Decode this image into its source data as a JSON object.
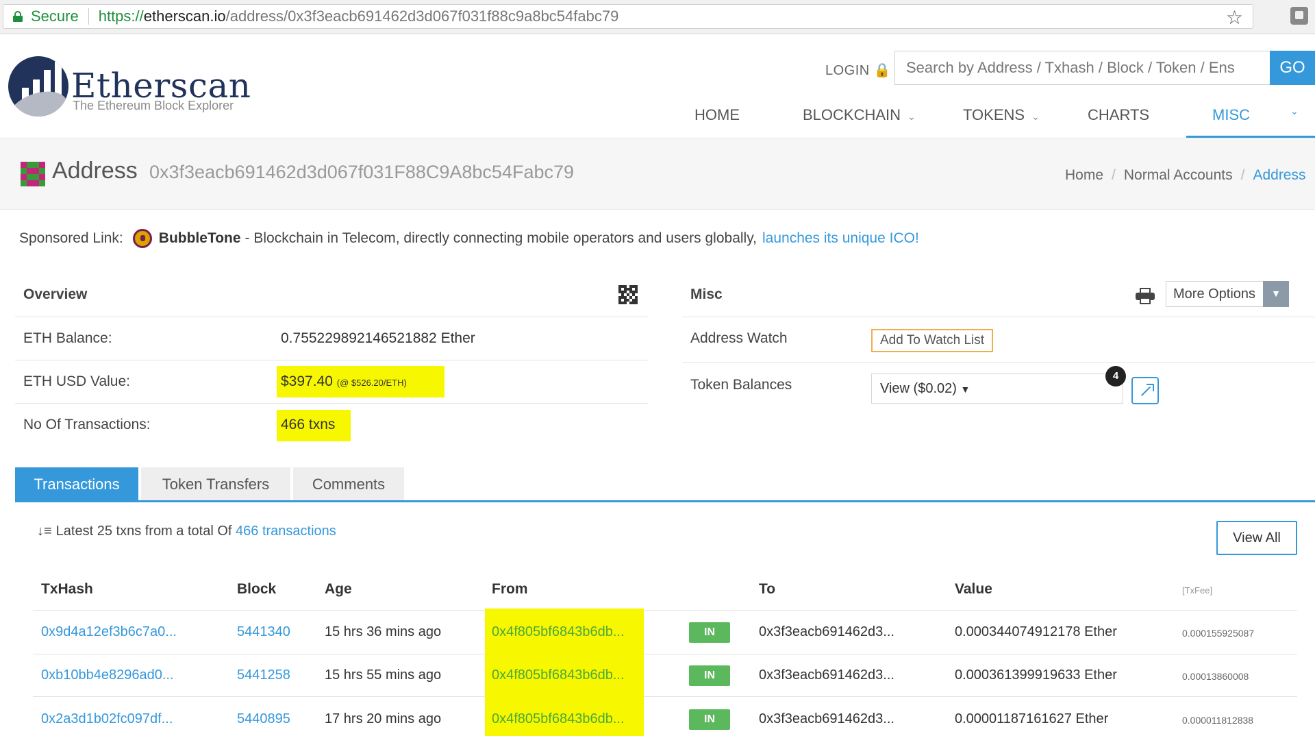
{
  "browser": {
    "secure_label": "Secure",
    "url_proto": "https://",
    "url_host": "etherscan.io",
    "url_path": "/address/0x3f3eacb691462d3d067f031f88c9a8bc54fabc79"
  },
  "header": {
    "logo_title": "Etherscan",
    "logo_subtitle": "The Ethereum Block Explorer",
    "login_label": "LOGIN",
    "search_placeholder": "Search by Address / Txhash / Block / Token / Ens",
    "go_label": "GO",
    "accent_color": "#3498db",
    "nav": [
      {
        "label": "HOME"
      },
      {
        "label": "BLOCKCHAIN"
      },
      {
        "label": "TOKENS"
      },
      {
        "label": "CHARTS"
      },
      {
        "label": "MISC"
      }
    ]
  },
  "address_bar": {
    "label": "Address",
    "hash": "0x3f3eacb691462d3d067f031F88C9A8bc54Fabc79",
    "breadcrumb": [
      "Home",
      "Normal Accounts",
      "Address"
    ]
  },
  "sponsored": {
    "prefix": "Sponsored Link:",
    "name": "BubbleTone",
    "text": "- Blockchain in Telecom, directly connecting mobile operators and users globally,",
    "link": "launches its unique ICO!"
  },
  "overview": {
    "title": "Overview",
    "rows": [
      {
        "label": "ETH Balance:",
        "value": "0.755229892146521882 Ether"
      },
      {
        "label": "ETH USD Value:",
        "value": "$397.40",
        "value_small": "(@ $526.20/ETH)"
      },
      {
        "label": "No Of Transactions:",
        "value": "466 txns"
      }
    ],
    "highlight_color": "#f7f700"
  },
  "misc": {
    "title": "Misc",
    "more_options_label": "More Options",
    "address_watch_label": "Address Watch",
    "watch_button_label": "Add To Watch List",
    "token_balances_label": "Token Balances",
    "token_select_value": "View ($0.02)",
    "token_badge": "4"
  },
  "tabs": [
    {
      "label": "Transactions"
    },
    {
      "label": "Token Transfers"
    },
    {
      "label": "Comments"
    }
  ],
  "transactions": {
    "summary_prefix": "Latest 25 txns from a total Of",
    "summary_link": "466 transactions",
    "view_all_label": "View All",
    "columns": [
      "TxHash",
      "Block",
      "Age",
      "From",
      "To",
      "Value",
      "[TxFee]"
    ],
    "rows": [
      {
        "hash": "0x9d4a12ef3b6c7a0...",
        "block": "5441340",
        "age": "15 hrs 36 mins ago",
        "from": "0x4f805bf6843b6db...",
        "direction": "IN",
        "to": "0x3f3eacb691462d3...",
        "value": "0.000344074912178 Ether",
        "fee": "0.000155925087"
      },
      {
        "hash": "0xb10bb4e8296ad0...",
        "block": "5441258",
        "age": "15 hrs 55 mins ago",
        "from": "0x4f805bf6843b6db...",
        "direction": "IN",
        "to": "0x3f3eacb691462d3...",
        "value": "0.000361399919633 Ether",
        "fee": "0.00013860008"
      },
      {
        "hash": "0x2a3d1b02fc097df...",
        "block": "5440895",
        "age": "17 hrs 20 mins ago",
        "from": "0x4f805bf6843b6db...",
        "direction": "IN",
        "to": "0x3f3eacb691462d3...",
        "value": "0.00001187161627 Ether",
        "fee": "0.000011812838"
      }
    ],
    "in_badge_color": "#5cb85c"
  }
}
